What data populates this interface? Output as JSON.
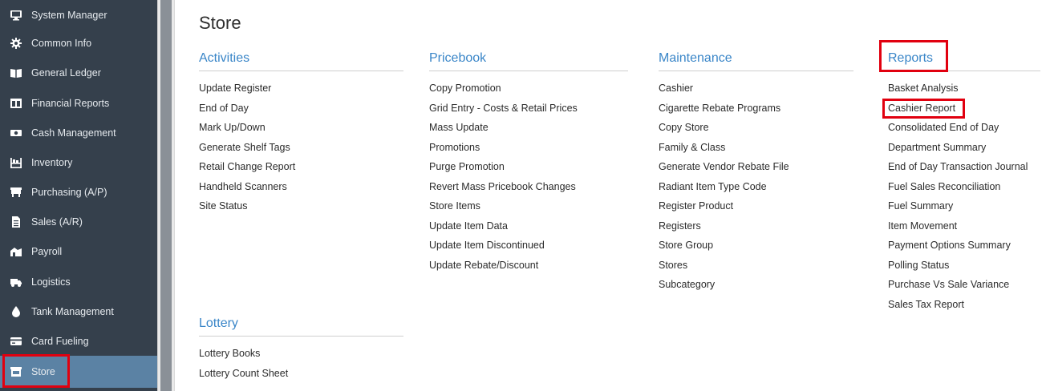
{
  "sidebar": {
    "items": [
      {
        "label": "System Manager",
        "icon": "monitor-icon"
      },
      {
        "label": "Common Info",
        "icon": "gear-icon"
      },
      {
        "label": "General Ledger",
        "icon": "book-icon"
      },
      {
        "label": "Financial Reports",
        "icon": "table-icon"
      },
      {
        "label": "Cash Management",
        "icon": "money-icon"
      },
      {
        "label": "Inventory",
        "icon": "shelf-icon"
      },
      {
        "label": "Purchasing (A/P)",
        "icon": "cart-icon"
      },
      {
        "label": "Sales (A/R)",
        "icon": "document-icon"
      },
      {
        "label": "Payroll",
        "icon": "payroll-icon"
      },
      {
        "label": "Logistics",
        "icon": "truck-icon"
      },
      {
        "label": "Tank Management",
        "icon": "drop-icon"
      },
      {
        "label": "Card Fueling",
        "icon": "card-icon"
      },
      {
        "label": "Store",
        "icon": "store-icon"
      }
    ],
    "active": "Store"
  },
  "page": {
    "title": "Store"
  },
  "sections": {
    "activities": {
      "title": "Activities",
      "items": [
        "Update Register",
        "End of Day",
        "Mark Up/Down",
        "Generate Shelf Tags",
        "Retail Change Report",
        "Handheld Scanners",
        "Site Status"
      ]
    },
    "pricebook": {
      "title": "Pricebook",
      "items": [
        "Copy Promotion",
        "Grid Entry - Costs & Retail Prices",
        "Mass Update",
        "Promotions",
        "Purge Promotion",
        "Revert Mass Pricebook Changes",
        "Store Items",
        "Update Item Data",
        "Update Item Discontinued",
        "Update Rebate/Discount"
      ]
    },
    "maintenance": {
      "title": "Maintenance",
      "items": [
        "Cashier",
        "Cigarette Rebate Programs",
        "Copy Store",
        "Family & Class",
        "Generate Vendor Rebate File",
        "Radiant Item Type Code",
        "Register Product",
        "Registers",
        "Store Group",
        "Stores",
        "Subcategory"
      ]
    },
    "reports": {
      "title": "Reports",
      "items": [
        "Basket Analysis",
        "Cashier Report",
        "Consolidated End of Day",
        "Department Summary",
        "End of Day Transaction Journal",
        "Fuel Sales Reconciliation",
        "Fuel Summary",
        "Item Movement",
        "Payment Options Summary",
        "Polling Status",
        "Purchase Vs Sale Variance",
        "Sales Tax Report"
      ]
    },
    "lottery": {
      "title": "Lottery",
      "items": [
        "Lottery Books",
        "Lottery Count Sheet"
      ]
    }
  },
  "colors": {
    "sidebar_bg": "#35404c",
    "active_bg": "#5b82a4",
    "link_blue": "#3a86c8",
    "highlight_red": "#e1000f"
  }
}
